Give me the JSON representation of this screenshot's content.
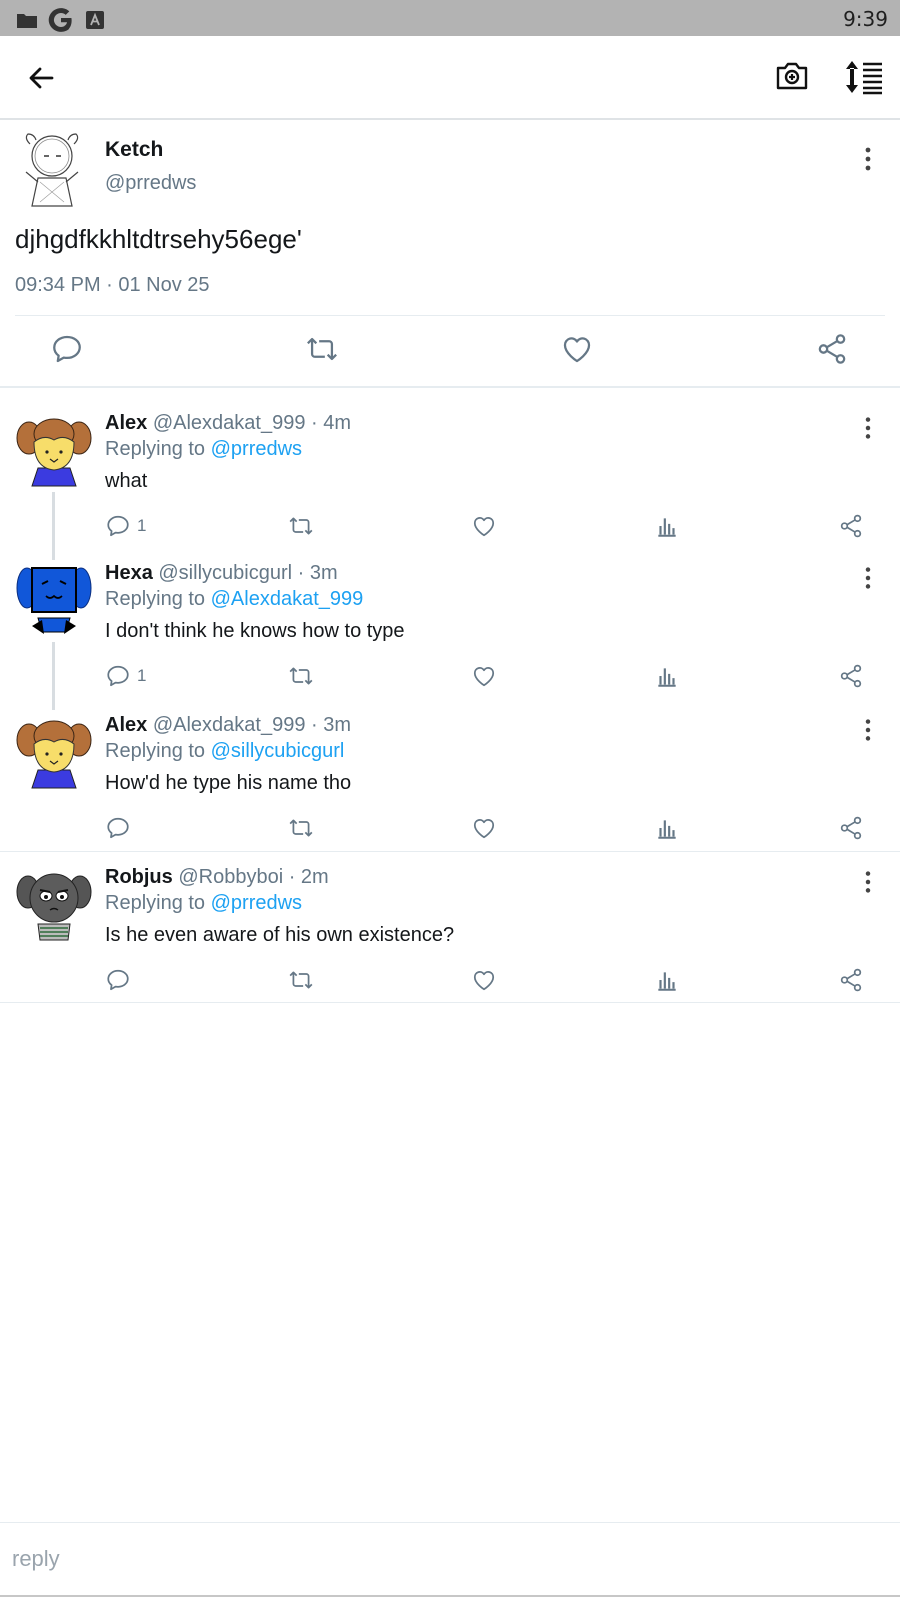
{
  "status_bar": {
    "time": "9:39",
    "icons": [
      "folder-icon",
      "google-icon",
      "font-icon"
    ]
  },
  "app_bar": {
    "icons": [
      "back-arrow-icon",
      "camera-add-icon",
      "sort-icon"
    ]
  },
  "tweet": {
    "name": "Ketch",
    "handle": "@prredws",
    "text": "djhgdfkkhltdtrsehy56ege'",
    "timestamp": "09:34 PM · 01 Nov 25"
  },
  "replies": [
    {
      "name": "Alex",
      "handle": "@Alexdakat_999",
      "time": "· 4m",
      "replying_prefix": "Replying to ",
      "replying_to": "@prredws",
      "text": "what",
      "reply_count": "1"
    },
    {
      "name": "Hexa",
      "handle": "@sillycubicgurl",
      "time": "· 3m",
      "replying_prefix": "Replying to ",
      "replying_to": "@Alexdakat_999",
      "text": "I don't think he knows how to type",
      "reply_count": "1"
    },
    {
      "name": "Alex",
      "handle": "@Alexdakat_999",
      "time": "· 3m",
      "replying_prefix": "Replying to ",
      "replying_to": "@sillycubicgurl",
      "text": "How'd he type his name tho",
      "reply_count": ""
    },
    {
      "name": "Robjus",
      "handle": "@Robbyboi",
      "time": "· 2m",
      "replying_prefix": "Replying to ",
      "replying_to": "@prredws",
      "text": "Is he even aware of his own existence?",
      "reply_count": ""
    }
  ],
  "reply_box": {
    "placeholder": "reply"
  },
  "colors": {
    "link": "#1da1f2",
    "muted": "#657786",
    "text": "#14171a",
    "status_bar": "#b3b3b3"
  }
}
